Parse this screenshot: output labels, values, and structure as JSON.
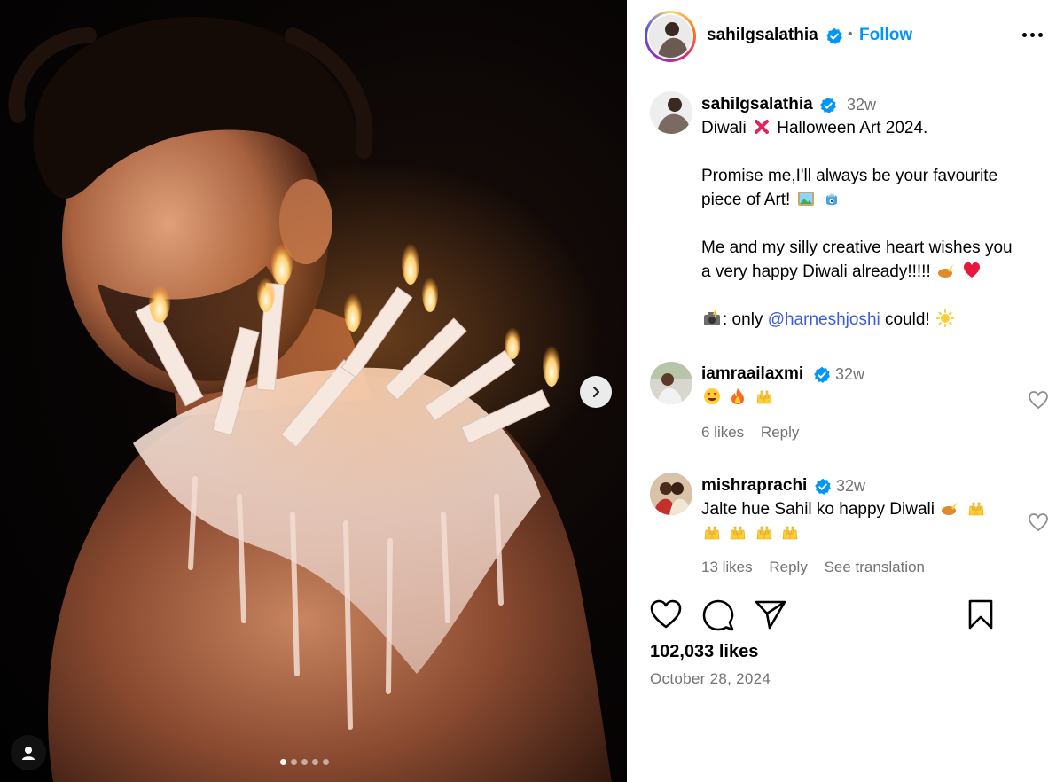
{
  "post": {
    "author": "sahilgsalathia",
    "follow_label": "Follow",
    "separator": "•",
    "likes": "102,033 likes",
    "date": "October 28, 2024",
    "carousel": {
      "count": 5,
      "active_index": 0
    }
  },
  "caption": {
    "username": "sahilgsalathia",
    "time": "32w",
    "line1_a": "Diwali",
    "line1_b": "Halloween Art 2024.",
    "line2": "Promise me,I'll always be your favourite",
    "line3": "piece of Art!",
    "line4": "Me and my silly creative heart wishes you",
    "line5": "a very happy Diwali already!!!!!",
    "line6_a": ": only",
    "line6_mention": "@harneshjoshi",
    "line6_b": "could!"
  },
  "comments": [
    {
      "username": "iamraailaxmi",
      "time": "32w",
      "likes": "6 likes",
      "reply": "Reply"
    },
    {
      "username": "mishraprachi",
      "time": "32w",
      "text": "Jalte hue Sahil ko happy Diwali",
      "likes": "13 likes",
      "reply": "Reply",
      "translate": "See translation"
    }
  ],
  "icons": {
    "verified": "verified-badge-icon",
    "more": "more-options-icon",
    "like": "heart-icon",
    "comment": "comment-bubble-icon",
    "share": "paper-plane-icon",
    "save": "bookmark-icon",
    "next": "chevron-right-icon",
    "tagged": "person-icon"
  },
  "colors": {
    "accent": "#0095f6",
    "verified": "#0095f6",
    "mention": "#3b5bdb",
    "muted": "#737373"
  }
}
